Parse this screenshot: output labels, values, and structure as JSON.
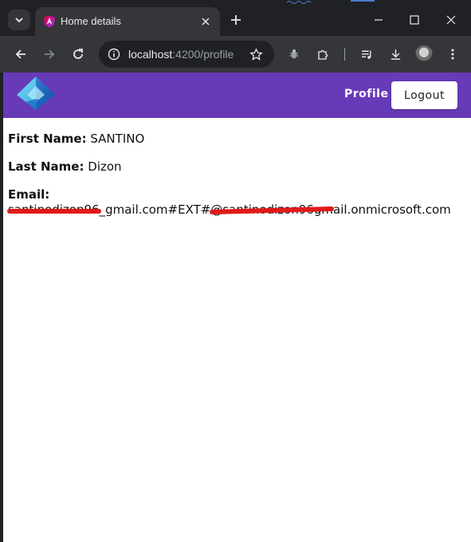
{
  "browser": {
    "tab": {
      "title": "Home details"
    },
    "omnibox": {
      "host": "localhost",
      "path": ":4200/profile"
    }
  },
  "icons": {
    "tab_search": "chevron-down-icon",
    "tab_favicon": "angular-icon",
    "tab_close": "close-icon",
    "new_tab": "plus-icon",
    "back": "arrow-left-icon",
    "forward": "arrow-right-icon",
    "reload": "reload-icon",
    "site_info": "info-icon",
    "bookmark": "star-icon",
    "extension_1": "bug-icon",
    "extensions": "puzzle-icon",
    "media": "playlist-icon",
    "downloads": "download-icon",
    "profile": "avatar-icon",
    "menu": "kebab-menu-icon",
    "minimize": "minimize-icon",
    "maximize": "maximize-icon",
    "close_window": "close-icon",
    "app_logo": "azure-ad-logo"
  },
  "app": {
    "header": {
      "nav_profile": "Profile",
      "logout_label": "Logout",
      "color": "#673ab7"
    },
    "profile": {
      "first_name_label": "First Name:",
      "first_name_value": "SANTINO",
      "last_name_label": "Last Name:",
      "last_name_value": "Dizon",
      "email_label": "Email:",
      "email_value": "santinodizon96_gmail.com#EXT#@santinodizon96gmail.onmicrosoft.com"
    }
  },
  "colors": {
    "redaction": "#e11919",
    "chrome_dark": "#202124",
    "chrome_toolbar": "#35363a"
  }
}
